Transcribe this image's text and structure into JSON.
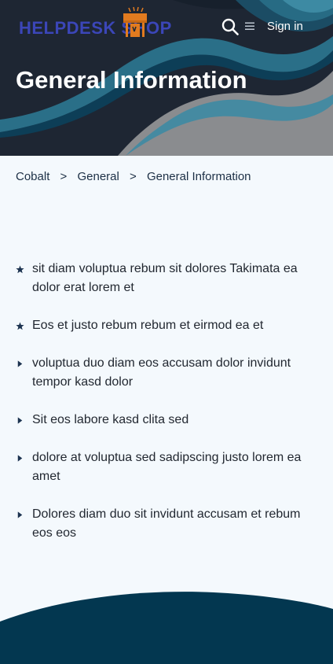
{
  "header": {
    "logo_text": "HELPDESK SHOP",
    "logo_icon": "shop-storefront-icon",
    "search_icon": "search-icon",
    "menu_icon": "hamburger-menu-icon",
    "signin_label": "Sign in",
    "page_title": "General Information"
  },
  "breadcrumb": {
    "items": [
      "Cobalt",
      "General",
      "General Information"
    ],
    "separator": ">"
  },
  "articles": [
    {
      "title": "sit diam voluptua rebum sit dolores Takimata ea dolor erat lorem et",
      "icon": "star-icon",
      "promoted": true
    },
    {
      "title": "Eos et justo rebum rebum et eirmod ea et",
      "icon": "star-icon",
      "promoted": true
    },
    {
      "title": "voluptua duo diam eos accusam dolor invidunt tempor kasd dolor",
      "icon": "caret-right-icon",
      "promoted": false
    },
    {
      "title": "Sit eos labore kasd clita sed",
      "icon": "caret-right-icon",
      "promoted": false
    },
    {
      "title": "dolore at voluptua sed sadipscing justo lorem ea amet",
      "icon": "caret-right-icon",
      "promoted": false
    },
    {
      "title": "Dolores diam duo sit invidunt accusam et rebum eos eos",
      "icon": "caret-right-icon",
      "promoted": false
    }
  ],
  "colors": {
    "hero_dark": "#1e2633",
    "wave_teal": "#2a6f88",
    "wave_deep": "#0d3e57",
    "hero_gray": "#8a8c8f",
    "logo_blue": "#3b46b8",
    "logo_orange": "#e27b1f",
    "text_dark": "#222831",
    "icon_navy": "#1c3350",
    "footer_navy": "#033750",
    "page_bg": "#f4f9fd"
  }
}
